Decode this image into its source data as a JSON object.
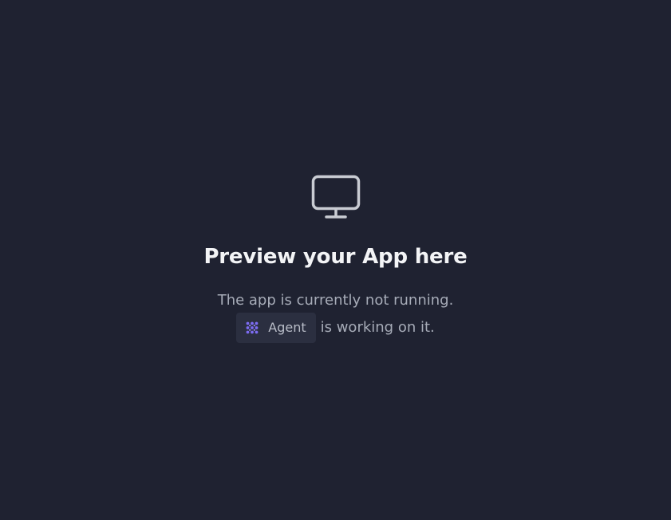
{
  "empty_state": {
    "icon": "monitor-icon",
    "title": "Preview your App here",
    "subtitle": "The app is currently not running.",
    "agent_chip": {
      "icon": "agent-dots-icon",
      "label": "Agent"
    },
    "agent_suffix": "is working on it."
  },
  "colors": {
    "background": "#1f2231",
    "chip_background": "#2b2f40",
    "agent_accent": "#7c6cf2",
    "icon_stroke": "#c9ccd3"
  }
}
